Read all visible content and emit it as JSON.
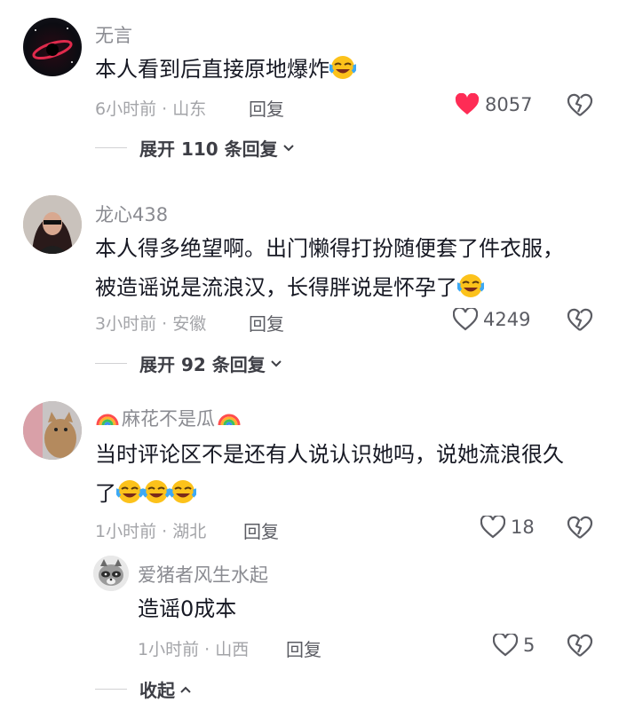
{
  "comments": [
    {
      "username": "无言",
      "text": "本人看到后直接原地爆炸",
      "emoji_count": 1,
      "meta": "6小时前 · 山东",
      "reply_label": "回复",
      "like_count": "8057",
      "liked": true,
      "expand_label": "展开 110 条回复"
    },
    {
      "username": "龙心438",
      "text_line1": "本人得多绝望啊。出门懒得打扮随便套了件衣服，",
      "text_line2": "被造谣说是流浪汉，长得胖说是怀孕了",
      "emoji_count": 1,
      "meta": "3小时前 · 安徽",
      "reply_label": "回复",
      "like_count": "4249",
      "liked": false,
      "expand_label": "展开 92 条回复"
    },
    {
      "username": "麻花不是瓜",
      "username_decoration": "rainbow-icon",
      "text_line1": "当时评论区不是还有人说认识她吗，说她流浪很久",
      "text_line2": "了",
      "emoji_count": 3,
      "meta": "1小时前 · 湖北",
      "reply_label": "回复",
      "like_count": "18",
      "liked": false
    }
  ],
  "sub_reply": {
    "username": "爱猪者风生水起",
    "text": "造谣0成本",
    "meta": "1小时前 · 山西",
    "reply_label": "回复",
    "like_count": "5",
    "liked": false
  },
  "collapse_label": "收起",
  "colors": {
    "like_active": "#fe2c55",
    "text": "#161823",
    "muted": "#a3a4a8"
  },
  "icons": [
    "heart-icon",
    "dislike-broken-heart-icon",
    "laughing-crying-emoji",
    "rainbow-icon",
    "chevron-down-icon",
    "chevron-up-icon"
  ]
}
